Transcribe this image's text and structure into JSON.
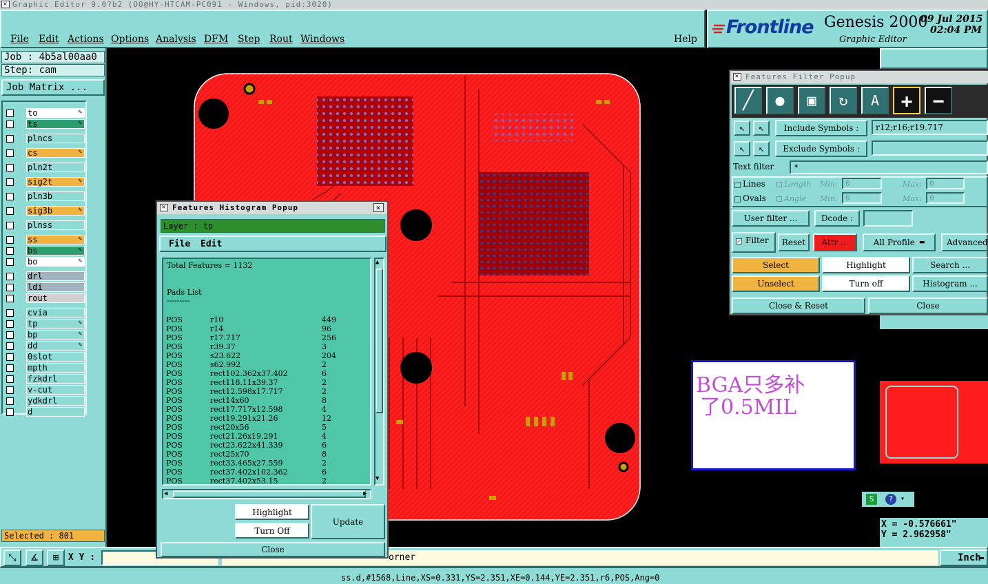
{
  "window": {
    "title": "Graphic Editor 9.0?b2  (OO@HY-HTCAM-PC091 - Windows, pid:3020)"
  },
  "menu": [
    "File",
    "Edit",
    "Actions",
    "Options",
    "Analysis",
    "DFM",
    "Step",
    "Rout",
    "Windows"
  ],
  "help_label": "Help",
  "brand": {
    "logo_text": "Frontline",
    "product": "Genesis 2000",
    "subtitle": "Graphic Editor",
    "date": "09 Jul 2015",
    "time": "02:04 PM"
  },
  "job": {
    "job_line": "Job : 4b5al00aa0",
    "step_line": "Step: cam",
    "matrix_button": "Job Matrix ..."
  },
  "layers": [
    {
      "name": "to",
      "color": "#ffffff",
      "pen": true
    },
    {
      "name": "ts",
      "color": "#2e9e70",
      "pen": true
    },
    {
      "name": "plncs",
      "color": "#8fdcd6",
      "pen": false
    },
    {
      "name": "cs",
      "color": "#f2b441",
      "pen": true
    },
    {
      "name": "pln2t",
      "color": "#8fdcd6",
      "pen": false
    },
    {
      "name": "sig2t",
      "color": "#f2b441",
      "pen": true
    },
    {
      "name": "pln3b",
      "color": "#8fdcd6",
      "pen": false
    },
    {
      "name": "sig3b",
      "color": "#f2b441",
      "pen": true
    },
    {
      "name": "plnss",
      "color": "#8fdcd6",
      "pen": false
    },
    {
      "name": "ss",
      "color": "#f2b441",
      "pen": true
    },
    {
      "name": "bs",
      "color": "#2e9e70",
      "pen": true
    },
    {
      "name": "bo",
      "color": "#ffffff",
      "pen": true
    },
    {
      "name": "drl",
      "color": "#9fb4bf",
      "pen": false
    },
    {
      "name": "ldi",
      "color": "#9fb4bf",
      "pen": false
    },
    {
      "name": "rout",
      "color": "#d0d0d0",
      "pen": false
    },
    {
      "name": "cvia",
      "color": "#8fdcd6",
      "pen": false
    },
    {
      "name": "tp",
      "color": "#8fdcd6",
      "pen": true
    },
    {
      "name": "bp",
      "color": "#8fdcd6",
      "pen": true
    },
    {
      "name": "dd",
      "color": "#8fdcd6",
      "pen": true
    },
    {
      "name": "0slot",
      "color": "#8fdcd6",
      "pen": false
    },
    {
      "name": "mpth",
      "color": "#8fdcd6",
      "pen": false
    },
    {
      "name": "fzkdrl",
      "color": "#8fdcd6",
      "pen": false
    },
    {
      "name": "v-cut",
      "color": "#8fdcd6",
      "pen": false
    },
    {
      "name": "ydkdrl",
      "color": "#8fdcd6",
      "pen": false
    },
    {
      "name": "d",
      "color": "#8fdcd6",
      "pen": false
    }
  ],
  "selected_text": "Selected : 801",
  "xy_label": "X Y :",
  "corner_text": "orner",
  "unit": "Inch",
  "coords": {
    "x": "X = -0.576661\"",
    "y": "Y = 2.962958\""
  },
  "status_line": "ss.d,#1568,Line,XS=0.331,YS=2.351,XE=0.144,YE=2.351,r6,POS,Ang=0",
  "annotation": {
    "line1": "BGA只多补",
    "line2": "了0.5MIL"
  },
  "histogram": {
    "title": "Features Histogram Popup",
    "layer_label": "Layer :  tp",
    "menu": [
      "File",
      "Edit"
    ],
    "total": "Total Features = 1132",
    "section": "Pads List",
    "underline": "---------",
    "rows": [
      {
        "pol": "POS",
        "sym": "r10",
        "count": "449"
      },
      {
        "pol": "POS",
        "sym": "r14",
        "count": "96"
      },
      {
        "pol": "POS",
        "sym": "r17.717",
        "count": "256"
      },
      {
        "pol": "POS",
        "sym": "r39.37",
        "count": "3"
      },
      {
        "pol": "POS",
        "sym": "s23.622",
        "count": "204"
      },
      {
        "pol": "POS",
        "sym": "s62.992",
        "count": "2"
      },
      {
        "pol": "POS",
        "sym": "rect102.362x37.402",
        "count": "6"
      },
      {
        "pol": "POS",
        "sym": "rect118.11x39.37",
        "count": "2"
      },
      {
        "pol": "POS",
        "sym": "rect12.598x17.717",
        "count": "2"
      },
      {
        "pol": "POS",
        "sym": "rect14x60",
        "count": "8"
      },
      {
        "pol": "POS",
        "sym": "rect17.717x12.598",
        "count": "4"
      },
      {
        "pol": "POS",
        "sym": "rect19.291x21.26",
        "count": "12"
      },
      {
        "pol": "POS",
        "sym": "rect20x56",
        "count": "5"
      },
      {
        "pol": "POS",
        "sym": "rect21.26x19.291",
        "count": "4"
      },
      {
        "pol": "POS",
        "sym": "rect23.622x41.339",
        "count": "6"
      },
      {
        "pol": "POS",
        "sym": "rect25x70",
        "count": "8"
      },
      {
        "pol": "POS",
        "sym": "rect33.465x27.559",
        "count": "2"
      },
      {
        "pol": "POS",
        "sym": "rect37.402x102.362",
        "count": "6"
      },
      {
        "pol": "POS",
        "sym": "rect37.402x53.15",
        "count": "2"
      }
    ],
    "buttons": {
      "highlight": "Highlight",
      "turn_off": "Turn Off",
      "update": "Update",
      "close": "Close"
    }
  },
  "filter": {
    "title": "Features Filter Popup",
    "include_label": "Include Symbols :",
    "include_value": "r12;r16;r19.717",
    "exclude_label": "Exclude Symbols :",
    "exclude_value": "",
    "text_filter_label": "Text filter",
    "text_filter_value": "*",
    "lines": "Lines",
    "ovals": "Ovals",
    "length": "Length",
    "angle": "Angle",
    "min_label": "Min:",
    "max_label": "Max:",
    "zero": "0",
    "user_filter": "User filter ...",
    "dcode": "Dcode :",
    "filter": "Filter",
    "reset": "Reset",
    "attr": "Attr ...",
    "profile": "All Profile",
    "advanced": "Advanced.",
    "select": "Select",
    "highlight": "Highlight",
    "search": "Search ...",
    "unselect": "Unselect",
    "turn_off": "Turn off",
    "histogram": "Histogram ...",
    "close_reset": "Close & Reset",
    "close": "Close"
  }
}
